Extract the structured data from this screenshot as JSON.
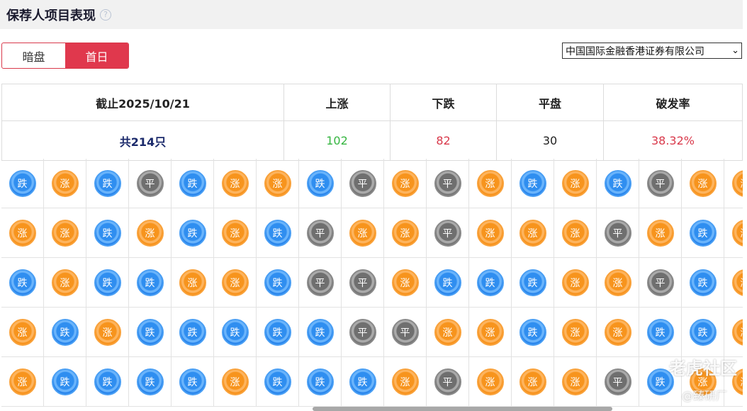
{
  "header": {
    "title": "保荐人项目表现",
    "help_icon": "?"
  },
  "tabs": [
    {
      "label": "暗盘",
      "active": false
    },
    {
      "label": "首日",
      "active": true
    }
  ],
  "sponsor_select": {
    "value": "中国国际金融香港证券有限公司"
  },
  "summary": {
    "headers": [
      "截止2025/10/21",
      "上涨",
      "下跌",
      "平盘",
      "破发率"
    ],
    "total": "共214只",
    "up": "102",
    "down": "82",
    "flat": "30",
    "break_rate": "38.32%"
  },
  "legend_labels": {
    "up": "涨",
    "down": "跌",
    "flat": "平"
  },
  "grid_rows": [
    [
      "跌",
      "涨",
      "跌",
      "平",
      "跌",
      "涨",
      "涨",
      "跌",
      "平",
      "涨",
      "平",
      "涨",
      "跌",
      "涨",
      "跌",
      "平",
      "涨",
      "涨"
    ],
    [
      "涨",
      "涨",
      "跌",
      "涨",
      "跌",
      "涨",
      "跌",
      "平",
      "涨",
      "涨",
      "平",
      "涨",
      "涨",
      "涨",
      "平",
      "涨",
      "跌",
      "涨"
    ],
    [
      "跌",
      "涨",
      "跌",
      "跌",
      "涨",
      "涨",
      "跌",
      "平",
      "平",
      "涨",
      "跌",
      "跌",
      "跌",
      "涨",
      "涨",
      "平",
      "跌",
      "涨"
    ],
    [
      "涨",
      "跌",
      "涨",
      "跌",
      "跌",
      "跌",
      "跌",
      "跌",
      "平",
      "平",
      "涨",
      "涨",
      "跌",
      "涨",
      "涨",
      "跌",
      "跌",
      "涨"
    ],
    [
      "涨",
      "跌",
      "跌",
      "跌",
      "跌",
      "涨",
      "跌",
      "跌",
      "跌",
      "涨",
      "平",
      "涨",
      "涨",
      "涨",
      "平",
      "跌",
      "涨",
      "涨"
    ]
  ],
  "colors": {
    "accent": "#e0384d",
    "up": "#f7941d",
    "down": "#2f8ef0",
    "flat": "#777777"
  },
  "watermark": {
    "line1": "老虎社区",
    "line2": "@臻研厂"
  }
}
